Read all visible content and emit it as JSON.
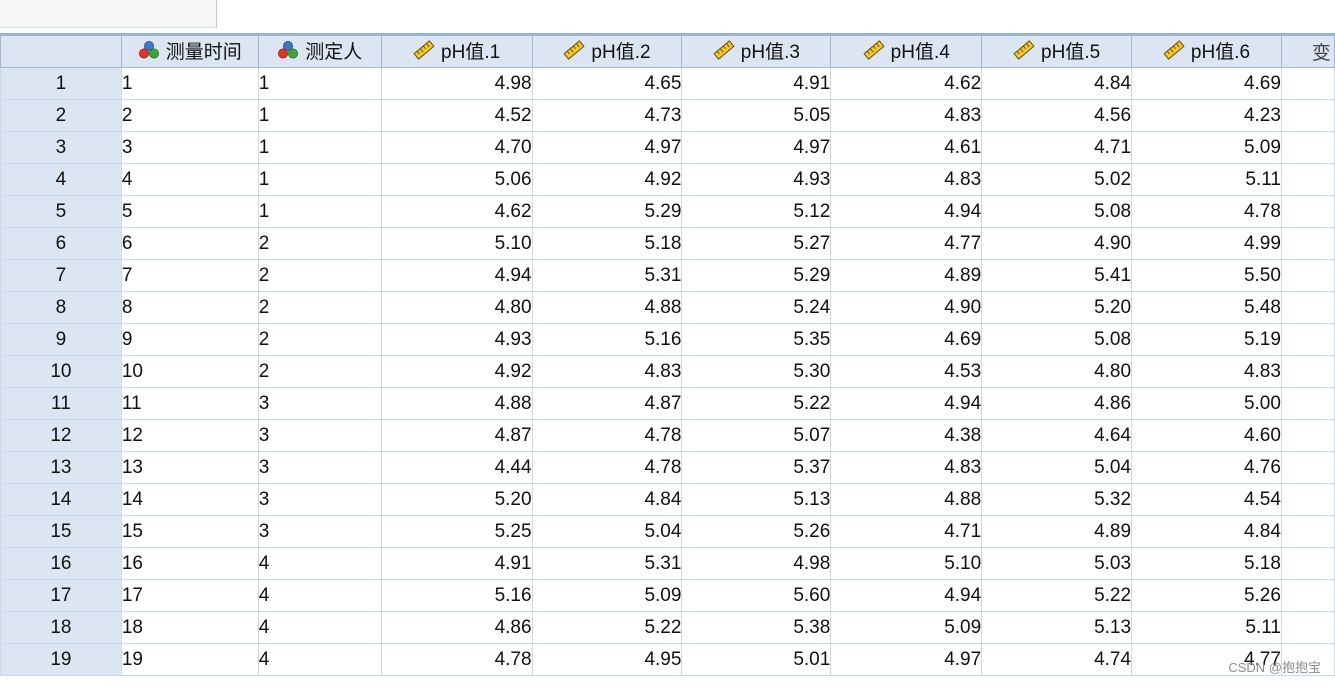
{
  "columns": [
    {
      "label": "测量时间",
      "icon": "nominal-measure-icon",
      "align": "left"
    },
    {
      "label": "测定人",
      "icon": "nominal-measure-icon",
      "align": "left"
    },
    {
      "label": "pH值.1",
      "icon": "scale-measure-icon",
      "align": "right"
    },
    {
      "label": "pH值.2",
      "icon": "scale-measure-icon",
      "align": "right"
    },
    {
      "label": "pH值.3",
      "icon": "scale-measure-icon",
      "align": "right"
    },
    {
      "label": "pH值.4",
      "icon": "scale-measure-icon",
      "align": "right"
    },
    {
      "label": "pH值.5",
      "icon": "scale-measure-icon",
      "align": "right"
    },
    {
      "label": "pH值.6",
      "icon": "scale-measure-icon",
      "align": "right"
    }
  ],
  "partial_column_label": "变",
  "rows": [
    {
      "n": "1",
      "cells": [
        "1",
        "1",
        "4.98",
        "4.65",
        "4.91",
        "4.62",
        "4.84",
        "4.69"
      ]
    },
    {
      "n": "2",
      "cells": [
        "2",
        "1",
        "4.52",
        "4.73",
        "5.05",
        "4.83",
        "4.56",
        "4.23"
      ]
    },
    {
      "n": "3",
      "cells": [
        "3",
        "1",
        "4.70",
        "4.97",
        "4.97",
        "4.61",
        "4.71",
        "5.09"
      ]
    },
    {
      "n": "4",
      "cells": [
        "4",
        "1",
        "5.06",
        "4.92",
        "4.93",
        "4.83",
        "5.02",
        "5.11"
      ]
    },
    {
      "n": "5",
      "cells": [
        "5",
        "1",
        "4.62",
        "5.29",
        "5.12",
        "4.94",
        "5.08",
        "4.78"
      ]
    },
    {
      "n": "6",
      "cells": [
        "6",
        "2",
        "5.10",
        "5.18",
        "5.27",
        "4.77",
        "4.90",
        "4.99"
      ]
    },
    {
      "n": "7",
      "cells": [
        "7",
        "2",
        "4.94",
        "5.31",
        "5.29",
        "4.89",
        "5.41",
        "5.50"
      ]
    },
    {
      "n": "8",
      "cells": [
        "8",
        "2",
        "4.80",
        "4.88",
        "5.24",
        "4.90",
        "5.20",
        "5.48"
      ]
    },
    {
      "n": "9",
      "cells": [
        "9",
        "2",
        "4.93",
        "5.16",
        "5.35",
        "4.69",
        "5.08",
        "5.19"
      ]
    },
    {
      "n": "10",
      "cells": [
        "10",
        "2",
        "4.92",
        "4.83",
        "5.30",
        "4.53",
        "4.80",
        "4.83"
      ]
    },
    {
      "n": "11",
      "cells": [
        "11",
        "3",
        "4.88",
        "4.87",
        "5.22",
        "4.94",
        "4.86",
        "5.00"
      ]
    },
    {
      "n": "12",
      "cells": [
        "12",
        "3",
        "4.87",
        "4.78",
        "5.07",
        "4.38",
        "4.64",
        "4.60"
      ]
    },
    {
      "n": "13",
      "cells": [
        "13",
        "3",
        "4.44",
        "4.78",
        "5.37",
        "4.83",
        "5.04",
        "4.76"
      ]
    },
    {
      "n": "14",
      "cells": [
        "14",
        "3",
        "5.20",
        "4.84",
        "5.13",
        "4.88",
        "5.32",
        "4.54"
      ]
    },
    {
      "n": "15",
      "cells": [
        "15",
        "3",
        "5.25",
        "5.04",
        "5.26",
        "4.71",
        "4.89",
        "4.84"
      ]
    },
    {
      "n": "16",
      "cells": [
        "16",
        "4",
        "4.91",
        "5.31",
        "4.98",
        "5.10",
        "5.03",
        "5.18"
      ]
    },
    {
      "n": "17",
      "cells": [
        "17",
        "4",
        "5.16",
        "5.09",
        "5.60",
        "4.94",
        "5.22",
        "5.26"
      ]
    },
    {
      "n": "18",
      "cells": [
        "18",
        "4",
        "4.86",
        "5.22",
        "5.38",
        "5.09",
        "5.13",
        "5.11"
      ]
    },
    {
      "n": "19",
      "cells": [
        "19",
        "4",
        "4.78",
        "4.95",
        "5.01",
        "4.97",
        "4.74",
        "4.77"
      ]
    }
  ],
  "watermark": "CSDN @抱抱宝",
  "colors": {
    "header_bg": "#dce6f2",
    "grid_line": "#c9d9ee",
    "header_border": "#9fb7d4"
  }
}
